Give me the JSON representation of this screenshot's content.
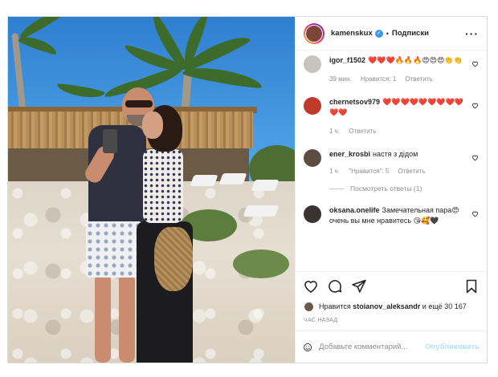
{
  "post": {
    "username": "kamenskux",
    "follow_label": "Подписки",
    "dot": "•",
    "verified_icon": "check-icon",
    "accent_color": "#3897f0"
  },
  "comments": [
    {
      "username": "igor_f1502",
      "text": "❤️❤️❤️🔥🔥🔥😍😍😍👏👏",
      "time": "39 мин.",
      "likes": "Нравится: 1",
      "reply": "Ответить",
      "avatar_color": "#c9c3bd"
    },
    {
      "username": "chernetsov979",
      "text": "❤️❤️❤️❤️❤️❤️❤️❤️❤️❤️❤️",
      "time": "1 ч.",
      "likes": "",
      "reply": "Ответить",
      "avatar_color": "#c0392b"
    },
    {
      "username": "ener_krosbi",
      "text": "настя з дідом",
      "time": "1 ч.",
      "likes": "\"Нравится\": 5",
      "reply": "Ответить",
      "avatar_color": "#5b4d42",
      "view_replies": "Посмотреть ответы (1)"
    },
    {
      "username": "oksana.onelife",
      "text": "Замечательная пара😍очень вы мне нравитесь 😘🥰🖤",
      "time": "",
      "likes": "",
      "reply": "",
      "avatar_color": "#3a3330"
    }
  ],
  "actions": {
    "like_icon": "heart-icon",
    "comment_icon": "comment-icon",
    "share_icon": "send-icon",
    "save_icon": "bookmark-icon"
  },
  "likes": {
    "prefix": "Нравится",
    "user": "stoianov_aleksandr",
    "suffix": "и ещё 30 167"
  },
  "timestamp": "ЧАС НАЗАД",
  "add_comment": {
    "placeholder": "Добавьте комментарий...",
    "publish_label": "Опубликовать"
  }
}
